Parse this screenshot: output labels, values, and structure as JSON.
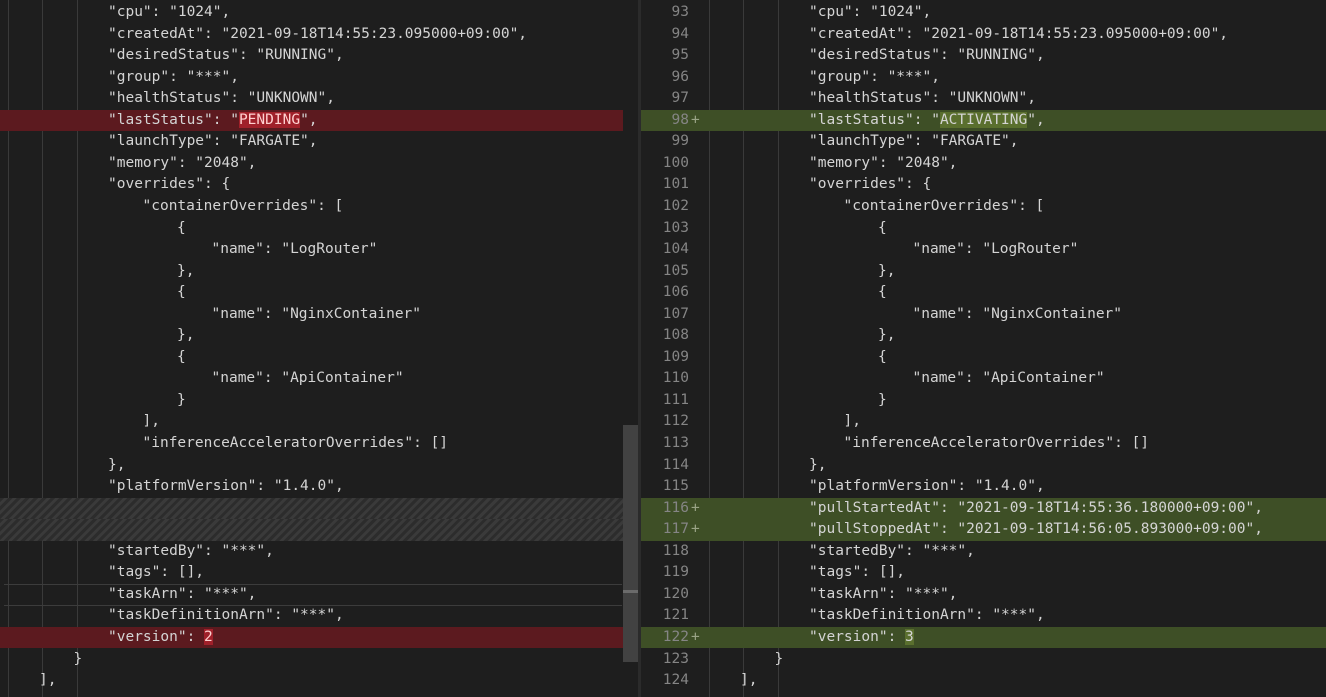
{
  "left_lines": [
    {
      "indent": 3,
      "text": "\"cpu\": \"1024\","
    },
    {
      "indent": 3,
      "text": "\"createdAt\": \"2021-09-18T14:55:23.095000+09:00\","
    },
    {
      "indent": 3,
      "text": "\"desiredStatus\": \"RUNNING\","
    },
    {
      "indent": 3,
      "text": "\"group\": \"***\","
    },
    {
      "indent": 3,
      "text": "\"healthStatus\": \"UNKNOWN\","
    },
    {
      "indent": 3,
      "pre": "\"lastStatus\": \"",
      "hl": "PENDING",
      "post": "\",",
      "type": "removed"
    },
    {
      "indent": 3,
      "text": "\"launchType\": \"FARGATE\","
    },
    {
      "indent": 3,
      "text": "\"memory\": \"2048\","
    },
    {
      "indent": 3,
      "text": "\"overrides\": {"
    },
    {
      "indent": 4,
      "text": "\"containerOverrides\": ["
    },
    {
      "indent": 5,
      "text": "{"
    },
    {
      "indent": 6,
      "text": "\"name\": \"LogRouter\""
    },
    {
      "indent": 5,
      "text": "},"
    },
    {
      "indent": 5,
      "text": "{"
    },
    {
      "indent": 6,
      "text": "\"name\": \"NginxContainer\""
    },
    {
      "indent": 5,
      "text": "},"
    },
    {
      "indent": 5,
      "text": "{"
    },
    {
      "indent": 6,
      "text": "\"name\": \"ApiContainer\""
    },
    {
      "indent": 5,
      "text": "}"
    },
    {
      "indent": 4,
      "text": "],"
    },
    {
      "indent": 4,
      "text": "\"inferenceAcceleratorOverrides\": []"
    },
    {
      "indent": 3,
      "text": "},"
    },
    {
      "indent": 3,
      "text": "\"platformVersion\": \"1.4.0\","
    },
    {
      "type": "filler"
    },
    {
      "type": "filler"
    },
    {
      "indent": 3,
      "text": "\"startedBy\": \"***\","
    },
    {
      "indent": 3,
      "text": "\"tags\": [],"
    },
    {
      "indent": 3,
      "text": "\"taskArn\": \"***\","
    },
    {
      "indent": 3,
      "text": "\"taskDefinitionArn\": \"***\","
    },
    {
      "indent": 3,
      "pre": "\"version\": ",
      "hl": "2",
      "post": "",
      "type": "removed"
    },
    {
      "indent": 2,
      "text": "}"
    },
    {
      "indent": 1,
      "text": "],"
    }
  ],
  "right_lines": [
    {
      "ln": "93",
      "indent": 3,
      "text": "\"cpu\": \"1024\","
    },
    {
      "ln": "94",
      "indent": 3,
      "text": "\"createdAt\": \"2021-09-18T14:55:23.095000+09:00\","
    },
    {
      "ln": "95",
      "indent": 3,
      "text": "\"desiredStatus\": \"RUNNING\","
    },
    {
      "ln": "96",
      "indent": 3,
      "text": "\"group\": \"***\","
    },
    {
      "ln": "97",
      "indent": 3,
      "text": "\"healthStatus\": \"UNKNOWN\","
    },
    {
      "ln": "98",
      "indent": 3,
      "pre": "\"lastStatus\": \"",
      "hl": "ACTIVATING",
      "post": "\",",
      "type": "added"
    },
    {
      "ln": "99",
      "indent": 3,
      "text": "\"launchType\": \"FARGATE\","
    },
    {
      "ln": "100",
      "indent": 3,
      "text": "\"memory\": \"2048\","
    },
    {
      "ln": "101",
      "indent": 3,
      "text": "\"overrides\": {"
    },
    {
      "ln": "102",
      "indent": 4,
      "text": "\"containerOverrides\": ["
    },
    {
      "ln": "103",
      "indent": 5,
      "text": "{"
    },
    {
      "ln": "104",
      "indent": 6,
      "text": "\"name\": \"LogRouter\""
    },
    {
      "ln": "105",
      "indent": 5,
      "text": "},"
    },
    {
      "ln": "106",
      "indent": 5,
      "text": "{"
    },
    {
      "ln": "107",
      "indent": 6,
      "text": "\"name\": \"NginxContainer\""
    },
    {
      "ln": "108",
      "indent": 5,
      "text": "},"
    },
    {
      "ln": "109",
      "indent": 5,
      "text": "{"
    },
    {
      "ln": "110",
      "indent": 6,
      "text": "\"name\": \"ApiContainer\""
    },
    {
      "ln": "111",
      "indent": 5,
      "text": "}"
    },
    {
      "ln": "112",
      "indent": 4,
      "text": "],"
    },
    {
      "ln": "113",
      "indent": 4,
      "text": "\"inferenceAcceleratorOverrides\": []"
    },
    {
      "ln": "114",
      "indent": 3,
      "text": "},"
    },
    {
      "ln": "115",
      "indent": 3,
      "text": "\"platformVersion\": \"1.4.0\","
    },
    {
      "ln": "116",
      "indent": 3,
      "text": "\"pullStartedAt\": \"2021-09-18T14:55:36.180000+09:00\",",
      "type": "added"
    },
    {
      "ln": "117",
      "indent": 3,
      "text": "\"pullStoppedAt\": \"2021-09-18T14:56:05.893000+09:00\",",
      "type": "added"
    },
    {
      "ln": "118",
      "indent": 3,
      "text": "\"startedBy\": \"***\","
    },
    {
      "ln": "119",
      "indent": 3,
      "text": "\"tags\": [],"
    },
    {
      "ln": "120",
      "indent": 3,
      "text": "\"taskArn\": \"***\","
    },
    {
      "ln": "121",
      "indent": 3,
      "text": "\"taskDefinitionArn\": \"***\","
    },
    {
      "ln": "122",
      "indent": 3,
      "pre": "\"version\": ",
      "hl": "3",
      "post": "",
      "type": "added"
    },
    {
      "ln": "123",
      "indent": 2,
      "text": "}"
    },
    {
      "ln": "124",
      "indent": 1,
      "text": "],"
    }
  ],
  "added_marker": "+",
  "colors": {
    "background": "#1e1e1e",
    "removed_line": "#5c1a1f",
    "removed_word": "#a0202a",
    "added_line": "#3e4f26",
    "added_word": "#5a6f2e",
    "line_number": "#858585"
  }
}
